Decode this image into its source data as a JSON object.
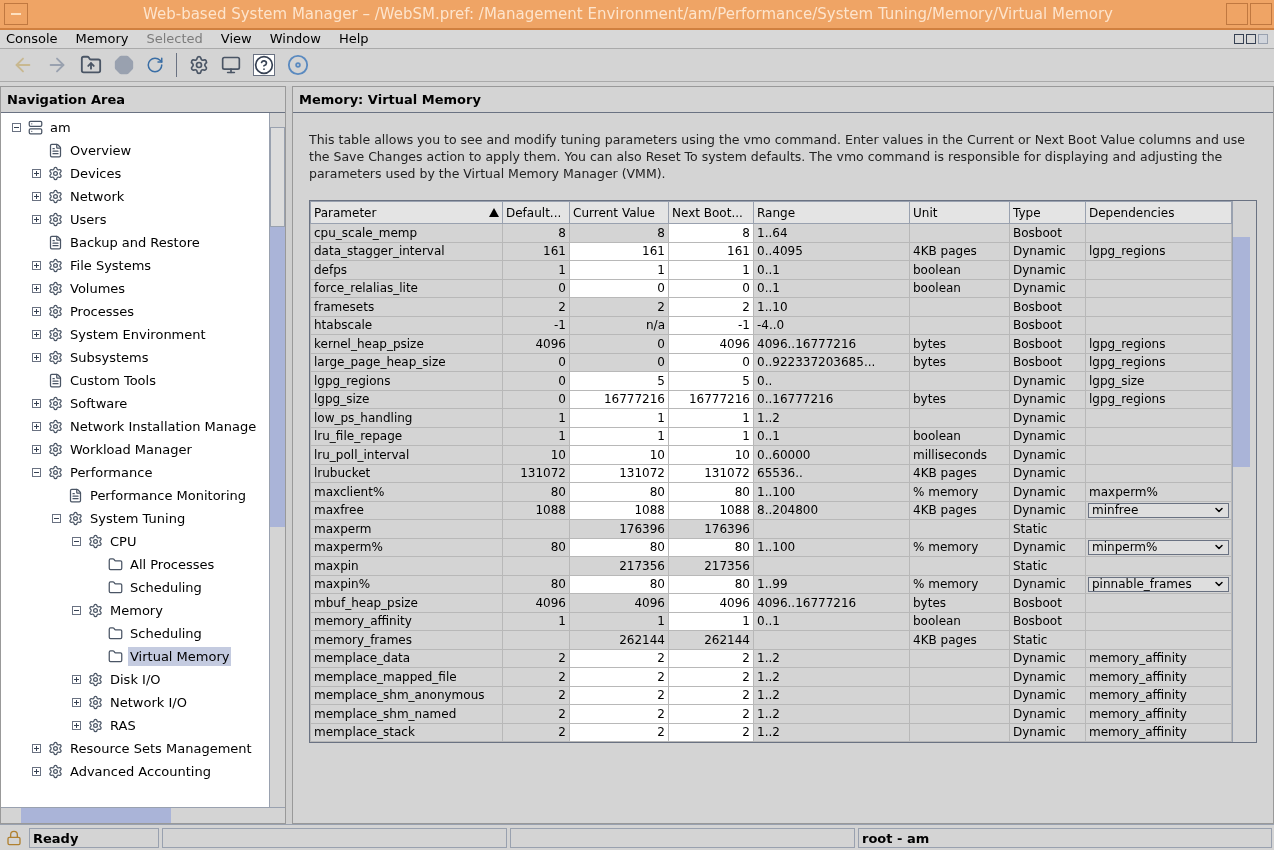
{
  "window": {
    "title": "Web-based System Manager – /WebSM.pref: /Management Environment/am/Performance/System Tuning/Memory/Virtual Memory"
  },
  "menu": [
    {
      "label": "Console",
      "disabled": false
    },
    {
      "label": "Memory",
      "disabled": false
    },
    {
      "label": "Selected",
      "disabled": true
    },
    {
      "label": "View",
      "disabled": false
    },
    {
      "label": "Window",
      "disabled": false
    },
    {
      "label": "Help",
      "disabled": false
    }
  ],
  "navigation": {
    "title": "Navigation Area",
    "tree": [
      {
        "label": "am",
        "expanded": true,
        "selected": false,
        "children": [
          {
            "label": "Overview",
            "selected": false
          },
          {
            "label": "Devices",
            "expanded": false,
            "selected": false
          },
          {
            "label": "Network",
            "expanded": false,
            "selected": false
          },
          {
            "label": "Users",
            "expanded": false,
            "selected": false
          },
          {
            "label": "Backup and Restore",
            "selected": false
          },
          {
            "label": "File Systems",
            "expanded": false,
            "selected": false
          },
          {
            "label": "Volumes",
            "expanded": false,
            "selected": false
          },
          {
            "label": "Processes",
            "expanded": false,
            "selected": false
          },
          {
            "label": "System Environment",
            "expanded": false,
            "selected": false
          },
          {
            "label": "Subsystems",
            "expanded": false,
            "selected": false
          },
          {
            "label": "Custom Tools",
            "selected": false
          },
          {
            "label": "Software",
            "expanded": false,
            "selected": false
          },
          {
            "label": "Network Installation Manage",
            "expanded": false,
            "selected": false
          },
          {
            "label": "Workload Manager",
            "expanded": false,
            "selected": false
          },
          {
            "label": "Performance",
            "expanded": true,
            "selected": false,
            "children": [
              {
                "label": "Performance Monitoring",
                "selected": false
              },
              {
                "label": "System Tuning",
                "expanded": true,
                "selected": false,
                "children": [
                  {
                    "label": "CPU",
                    "expanded": true,
                    "selected": false,
                    "children": [
                      {
                        "label": "All Processes",
                        "selected": false
                      },
                      {
                        "label": "Scheduling",
                        "selected": false
                      }
                    ]
                  },
                  {
                    "label": "Memory",
                    "expanded": true,
                    "selected": false,
                    "children": [
                      {
                        "label": "Scheduling",
                        "selected": false
                      },
                      {
                        "label": "Virtual Memory",
                        "selected": true
                      }
                    ]
                  },
                  {
                    "label": "Disk I/O",
                    "expanded": false,
                    "selected": false
                  },
                  {
                    "label": "Network I/O",
                    "expanded": false,
                    "selected": false
                  },
                  {
                    "label": "RAS",
                    "expanded": false,
                    "selected": false
                  }
                ]
              }
            ]
          },
          {
            "label": "Resource Sets Management",
            "expanded": false,
            "selected": false
          },
          {
            "label": "Advanced Accounting",
            "expanded": false,
            "selected": false
          }
        ]
      }
    ]
  },
  "content": {
    "title": "Memory: Virtual Memory",
    "description": "This table allows you to see and modify tuning parameters using the vmo command. Enter values in the Current or Next Boot Value columns and use the Save Changes action to apply them. You can also Reset To system defaults. The vmo command is responsible for displaying and adjusting the parameters used by the Virtual Memory Manager (VMM).",
    "table": {
      "columns": [
        {
          "label": "Parameter",
          "sorted": true
        },
        {
          "label": "Default...",
          "sorted": false
        },
        {
          "label": "Current Value",
          "sorted": false
        },
        {
          "label": "Next Boot...",
          "sorted": false
        },
        {
          "label": "Range",
          "sorted": false
        },
        {
          "label": "Unit",
          "sorted": false
        },
        {
          "label": "Type",
          "sorted": false
        },
        {
          "label": "Dependencies",
          "sorted": false
        }
      ],
      "rows": [
        {
          "parameter": "cpu_scale_memp",
          "default": "8",
          "current": "8",
          "next_boot": "8",
          "range": "1..64",
          "type": "Bosboot",
          "current_editable": false,
          "next_editable": true,
          "dependency_dropdown": false
        },
        {
          "parameter": "data_stagger_interval",
          "default": "161",
          "current": "161",
          "next_boot": "161",
          "range": "0..4095",
          "unit": "4KB pages",
          "type": "Dynamic",
          "dependencies": "lgpg_regions",
          "current_editable": true,
          "next_editable": true,
          "dependency_dropdown": false
        },
        {
          "parameter": "defps",
          "default": "1",
          "current": "1",
          "next_boot": "1",
          "range": "0..1",
          "unit": "boolean",
          "type": "Dynamic",
          "current_editable": true,
          "next_editable": true,
          "dependency_dropdown": false
        },
        {
          "parameter": "force_relalias_lite",
          "default": "0",
          "current": "0",
          "next_boot": "0",
          "range": "0..1",
          "unit": "boolean",
          "type": "Dynamic",
          "current_editable": true,
          "next_editable": true,
          "dependency_dropdown": false
        },
        {
          "parameter": "framesets",
          "default": "2",
          "current": "2",
          "next_boot": "2",
          "range": "1..10",
          "type": "Bosboot",
          "current_editable": false,
          "next_editable": true,
          "dependency_dropdown": false
        },
        {
          "parameter": "htabscale",
          "default": "-1",
          "current": "n/a",
          "next_boot": "-1",
          "range": "-4..0",
          "type": "Bosboot",
          "current_editable": false,
          "next_editable": true,
          "dependency_dropdown": false
        },
        {
          "parameter": "kernel_heap_psize",
          "default": "4096",
          "current": "0",
          "next_boot": "4096",
          "range": "4096..16777216",
          "unit": "bytes",
          "type": "Bosboot",
          "dependencies": "lgpg_regions",
          "current_editable": false,
          "next_editable": true,
          "dependency_dropdown": false
        },
        {
          "parameter": "large_page_heap_size",
          "default": "0",
          "current": "0",
          "next_boot": "0",
          "range": "0..922337203685...",
          "unit": "bytes",
          "type": "Bosboot",
          "dependencies": "lgpg_regions",
          "current_editable": false,
          "next_editable": true,
          "dependency_dropdown": false
        },
        {
          "parameter": "lgpg_regions",
          "default": "0",
          "current": "5",
          "next_boot": "5",
          "range": "0..",
          "type": "Dynamic",
          "dependencies": "lgpg_size",
          "current_editable": true,
          "next_editable": true,
          "dependency_dropdown": false
        },
        {
          "parameter": "lgpg_size",
          "default": "0",
          "current": "16777216",
          "next_boot": "16777216",
          "range": "0..16777216",
          "unit": "bytes",
          "type": "Dynamic",
          "dependencies": "lgpg_regions",
          "current_editable": true,
          "next_editable": true,
          "dependency_dropdown": false
        },
        {
          "parameter": "low_ps_handling",
          "default": "1",
          "current": "1",
          "next_boot": "1",
          "range": "1..2",
          "type": "Dynamic",
          "current_editable": true,
          "next_editable": true,
          "dependency_dropdown": false
        },
        {
          "parameter": "lru_file_repage",
          "default": "1",
          "current": "1",
          "next_boot": "1",
          "range": "0..1",
          "unit": "boolean",
          "type": "Dynamic",
          "current_editable": true,
          "next_editable": true,
          "dependency_dropdown": false
        },
        {
          "parameter": "lru_poll_interval",
          "default": "10",
          "current": "10",
          "next_boot": "10",
          "range": "0..60000",
          "unit": "milliseconds",
          "type": "Dynamic",
          "current_editable": true,
          "next_editable": true,
          "dependency_dropdown": false
        },
        {
          "parameter": "lrubucket",
          "default": "131072",
          "current": "131072",
          "next_boot": "131072",
          "range": "65536..",
          "unit": "4KB pages",
          "type": "Dynamic",
          "current_editable": true,
          "next_editable": true,
          "dependency_dropdown": false
        },
        {
          "parameter": "maxclient%",
          "default": "80",
          "current": "80",
          "next_boot": "80",
          "range": "1..100",
          "unit": "% memory",
          "type": "Dynamic",
          "dependencies": "maxperm%",
          "current_editable": true,
          "next_editable": true,
          "dependency_dropdown": false
        },
        {
          "parameter": "maxfree",
          "default": "1088",
          "current": "1088",
          "next_boot": "1088",
          "range": "8..204800",
          "unit": "4KB pages",
          "type": "Dynamic",
          "dependencies": "minfree",
          "current_editable": true,
          "next_editable": true,
          "dependency_dropdown": true
        },
        {
          "parameter": "maxperm",
          "current": "176396",
          "next_boot": "176396",
          "type": "Static",
          "current_editable": false,
          "next_editable": false,
          "dependency_dropdown": false
        },
        {
          "parameter": "maxperm%",
          "default": "80",
          "current": "80",
          "next_boot": "80",
          "range": "1..100",
          "unit": "% memory",
          "type": "Dynamic",
          "dependencies": "minperm%",
          "current_editable": true,
          "next_editable": true,
          "dependency_dropdown": true
        },
        {
          "parameter": "maxpin",
          "current": "217356",
          "next_boot": "217356",
          "type": "Static",
          "current_editable": false,
          "next_editable": false,
          "dependency_dropdown": false
        },
        {
          "parameter": "maxpin%",
          "default": "80",
          "current": "80",
          "next_boot": "80",
          "range": "1..99",
          "unit": "% memory",
          "type": "Dynamic",
          "dependencies": "pinnable_frames",
          "current_editable": true,
          "next_editable": true,
          "dependency_dropdown": true
        },
        {
          "parameter": "mbuf_heap_psize",
          "default": "4096",
          "current": "4096",
          "next_boot": "4096",
          "range": "4096..16777216",
          "unit": "bytes",
          "type": "Bosboot",
          "current_editable": false,
          "next_editable": true,
          "dependency_dropdown": false
        },
        {
          "parameter": "memory_affinity",
          "default": "1",
          "current": "1",
          "next_boot": "1",
          "range": "0..1",
          "unit": "boolean",
          "type": "Bosboot",
          "current_editable": false,
          "next_editable": true,
          "dependency_dropdown": false
        },
        {
          "parameter": "memory_frames",
          "current": "262144",
          "next_boot": "262144",
          "unit": "4KB pages",
          "type": "Static",
          "current_editable": false,
          "next_editable": false,
          "dependency_dropdown": false
        },
        {
          "parameter": "memplace_data",
          "default": "2",
          "current": "2",
          "next_boot": "2",
          "range": "1..2",
          "type": "Dynamic",
          "dependencies": "memory_affinity",
          "current_editable": true,
          "next_editable": true,
          "dependency_dropdown": false
        },
        {
          "parameter": "memplace_mapped_file",
          "default": "2",
          "current": "2",
          "next_boot": "2",
          "range": "1..2",
          "type": "Dynamic",
          "dependencies": "memory_affinity",
          "current_editable": true,
          "next_editable": true,
          "dependency_dropdown": false
        },
        {
          "parameter": "memplace_shm_anonymous",
          "default": "2",
          "current": "2",
          "next_boot": "2",
          "range": "1..2",
          "type": "Dynamic",
          "dependencies": "memory_affinity",
          "current_editable": true,
          "next_editable": true,
          "dependency_dropdown": false
        },
        {
          "parameter": "memplace_shm_named",
          "default": "2",
          "current": "2",
          "next_boot": "2",
          "range": "1..2",
          "type": "Dynamic",
          "dependencies": "memory_affinity",
          "current_editable": true,
          "next_editable": true,
          "dependency_dropdown": false
        },
        {
          "parameter": "memplace_stack",
          "default": "2",
          "current": "2",
          "next_boot": "2",
          "range": "1..2",
          "type": "Dynamic",
          "dependencies": "memory_affinity",
          "current_editable": true,
          "next_editable": true,
          "dependency_dropdown": false
        }
      ]
    }
  },
  "status_bar": {
    "message": "Ready",
    "user": "root - am"
  }
}
